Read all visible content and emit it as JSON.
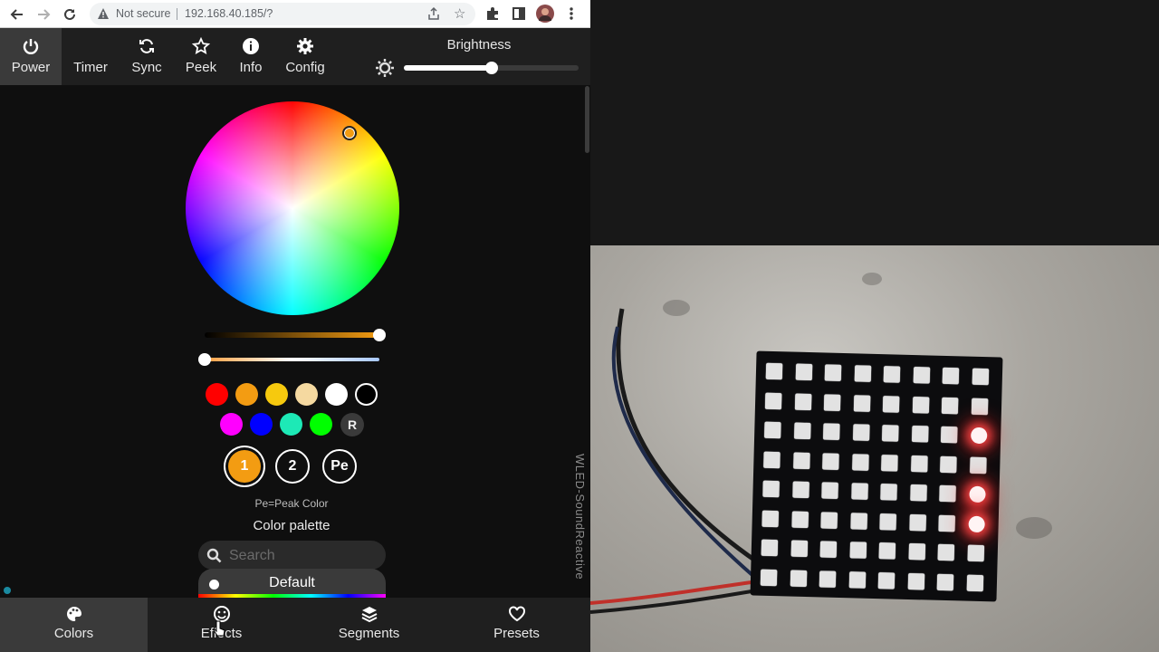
{
  "browser": {
    "security_label": "Not secure",
    "url": "192.168.40.185/?"
  },
  "topbar": {
    "tabs": [
      {
        "label": "Power",
        "icon": "power-icon"
      },
      {
        "label": "Timer",
        "icon": "moon-icon"
      },
      {
        "label": "Sync",
        "icon": "sync-icon"
      },
      {
        "label": "Peek",
        "icon": "star-icon"
      },
      {
        "label": "Info",
        "icon": "info-icon"
      },
      {
        "label": "Config",
        "icon": "gear-icon"
      }
    ],
    "brightness_label": "Brightness",
    "brightness_level": 0.5
  },
  "color": {
    "selected_color": "#f39c12",
    "sliders": {
      "intensity_level": 1.0,
      "white_level": 0.0
    },
    "quick_colors_row1": [
      "#ff0000",
      "#f39c12",
      "#f6c90e",
      "#f5d9a0",
      "#ffffff",
      "#000000"
    ],
    "quick_colors_row2": [
      "#ff00ff",
      "#0000ff",
      "#1de9b6",
      "#00ff00"
    ],
    "random_label": "R",
    "slots": [
      "1",
      "2",
      "Pe"
    ],
    "peak_note": "Pe=Peak Color",
    "palette_title": "Color palette",
    "search_placeholder": "Search",
    "selected_palette": "Default",
    "side_label": "WLED-SoundReactive"
  },
  "bottombar": {
    "tabs": [
      {
        "label": "Colors",
        "icon": "palette-icon"
      },
      {
        "label": "Effects",
        "icon": "smiley-icon"
      },
      {
        "label": "Segments",
        "icon": "layers-icon"
      },
      {
        "label": "Presets",
        "icon": "heart-icon"
      }
    ]
  },
  "video": {
    "matrix_rows": 8,
    "matrix_cols": 8,
    "lit_leds": [
      "2,7",
      "4,7",
      "5,7"
    ]
  }
}
